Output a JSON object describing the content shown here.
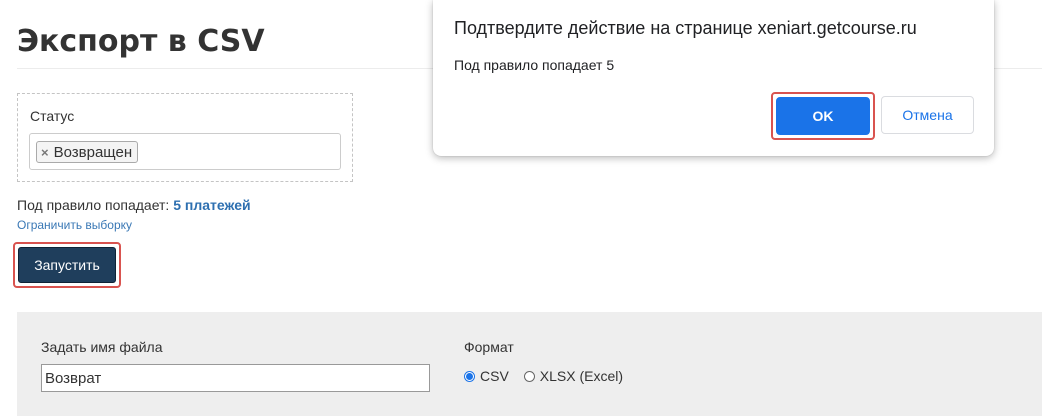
{
  "page": {
    "title": "Экспорт в CSV"
  },
  "filter": {
    "label": "Статус",
    "tag_remove_glyph": "×",
    "tags": [
      "Возвращен"
    ]
  },
  "match": {
    "prefix": "Под правило попадает:",
    "count_link": "5 платежей",
    "limit_link": "Ограничить выборку"
  },
  "run_button": {
    "label": "Запустить"
  },
  "options": {
    "filename_label": "Задать имя файла",
    "filename_value": "Возврат",
    "format_label": "Формат",
    "formats": [
      {
        "label": "CSV",
        "checked": true
      },
      {
        "label": "XLSX (Excel)",
        "checked": false
      }
    ]
  },
  "dialog": {
    "title": "Подтвердите действие на странице xeniart.getcourse.ru",
    "message": "Под правило попадает 5",
    "ok_label": "OK",
    "cancel_label": "Отмена"
  },
  "colors": {
    "accent": "#1a73e8",
    "run_button_bg": "#1f3e5c",
    "highlight": "#d9534f",
    "link": "#2d6fb0",
    "panel_bg": "#eeeeee"
  }
}
